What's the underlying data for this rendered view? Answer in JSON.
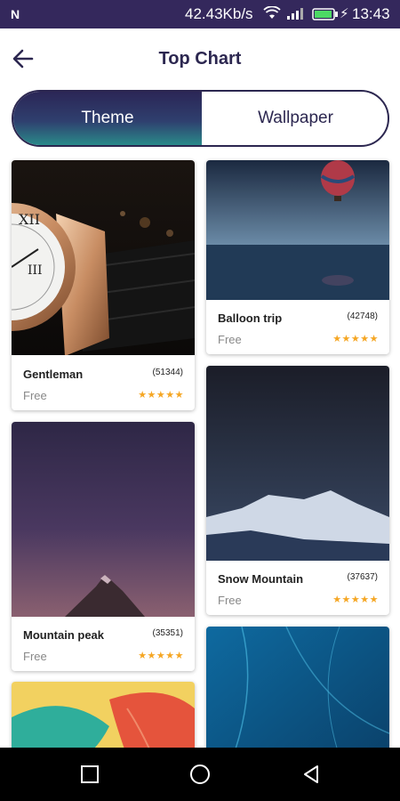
{
  "status_bar": {
    "left_icon": "N",
    "network_speed": "42.43Kb/s",
    "time": "13:43",
    "icons": [
      "wifi-icon",
      "signal-icon",
      "battery-icon",
      "charging-bolt-icon"
    ]
  },
  "header": {
    "title": "Top Chart",
    "back_icon": "arrow-left-icon"
  },
  "tabs": {
    "theme": "Theme",
    "wallpaper": "Wallpaper",
    "active": "Theme"
  },
  "cards": [
    {
      "name": "Gentleman",
      "count": "(51344)",
      "price": "Free",
      "rating": 5,
      "stars": "★★★★★"
    },
    {
      "name": "Mountain peak",
      "count": "(35351)",
      "price": "Free",
      "rating": 5,
      "stars": "★★★★★"
    },
    {
      "name": "Balloon trip",
      "count": "(42748)",
      "price": "Free",
      "rating": 5,
      "stars": "★★★★★"
    },
    {
      "name": "Snow Mountain",
      "count": "(37637)",
      "price": "Free",
      "rating": 5,
      "stars": "★★★★★"
    }
  ],
  "colors": {
    "status_bar": "#34285c",
    "title_text": "#2c2750",
    "tab_gradient_top": "#2b2656",
    "tab_gradient_bottom": "#2a8a8a",
    "star": "#f5a623"
  },
  "nav_bar": {
    "icons": [
      "recent-apps-icon",
      "home-icon",
      "back-triangle-icon"
    ]
  }
}
